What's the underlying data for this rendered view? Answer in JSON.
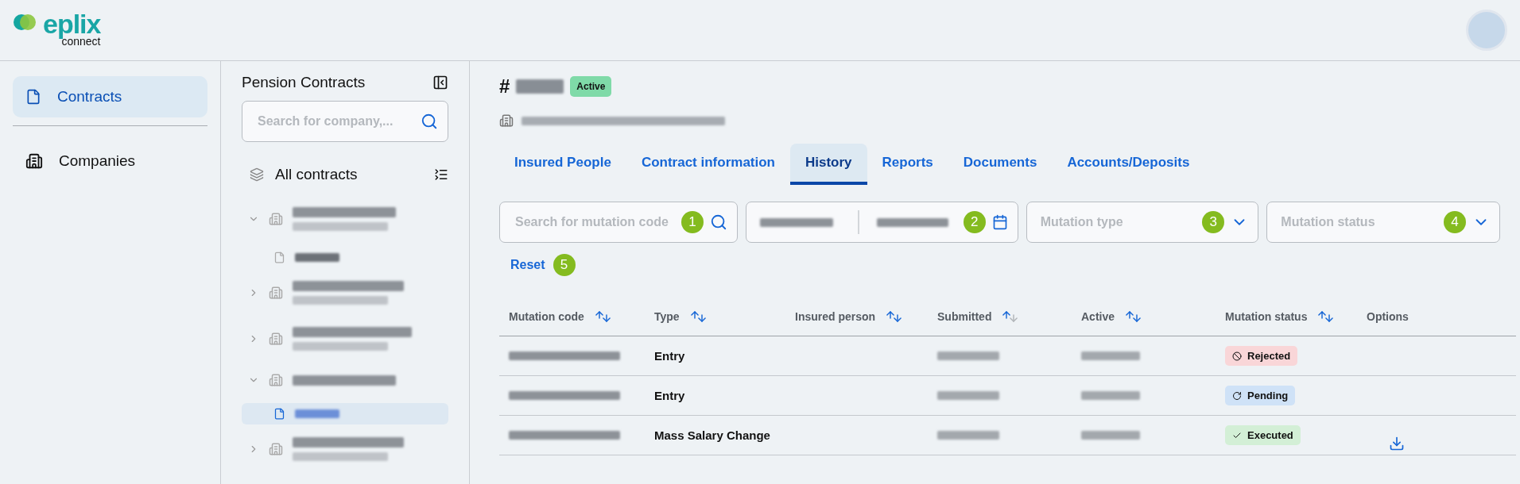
{
  "logo": {
    "name": "eplix",
    "subtitle": "connect"
  },
  "nav": [
    {
      "label": "Contracts",
      "kind": "contract",
      "selected": true
    },
    {
      "label": "Companies",
      "kind": "company",
      "selected": false
    }
  ],
  "contracts_panel": {
    "title": "Pension Contracts",
    "search": {
      "placeholder": "Search for company,..."
    },
    "root": "All contracts",
    "tree": [
      {
        "kind": "company",
        "expanded": true,
        "children": [
          {
            "kind": "contract",
            "selected": false
          }
        ]
      },
      {
        "kind": "company",
        "expanded": false
      },
      {
        "kind": "company",
        "expanded": false
      },
      {
        "kind": "company",
        "expanded": true,
        "children": [
          {
            "kind": "contract",
            "selected": true
          }
        ]
      },
      {
        "kind": "company",
        "expanded": false
      }
    ]
  },
  "contract": {
    "prefix": "#",
    "status": "Active"
  },
  "tabs": [
    {
      "label": "Insured People",
      "selected": false
    },
    {
      "label": "Contract information",
      "selected": false
    },
    {
      "label": "History",
      "selected": true
    },
    {
      "label": "Reports",
      "selected": false
    },
    {
      "label": "Documents",
      "selected": false
    },
    {
      "label": "Accounts/Deposits",
      "selected": false
    }
  ],
  "filters": {
    "search": {
      "placeholder": "Search for mutation code",
      "marker": "1"
    },
    "date_range": {
      "marker": "2"
    },
    "mutation_type": {
      "placeholder": "Mutation type",
      "marker": "3"
    },
    "mutation_status": {
      "placeholder": "Mutation status",
      "marker": "4"
    },
    "reset": {
      "label": "Reset",
      "marker": "5"
    }
  },
  "table": {
    "columns": [
      {
        "label": "Mutation code",
        "sorted": false
      },
      {
        "label": "Type",
        "sorted": false
      },
      {
        "label": "Insured person",
        "sorted": false
      },
      {
        "label": "Submitted",
        "sorted": true
      },
      {
        "label": "Active",
        "sorted": false
      },
      {
        "label": "Mutation status",
        "sorted": false
      },
      {
        "label": "Options"
      }
    ],
    "rows": [
      {
        "type": "Entry",
        "status": {
          "label": "Rejected",
          "kind": "rejected"
        },
        "download": false
      },
      {
        "type": "Entry",
        "status": {
          "label": "Pending",
          "kind": "pending"
        },
        "download": false
      },
      {
        "type": "Mass Salary Change",
        "status": {
          "label": "Executed",
          "kind": "executed"
        },
        "download": true
      }
    ]
  }
}
